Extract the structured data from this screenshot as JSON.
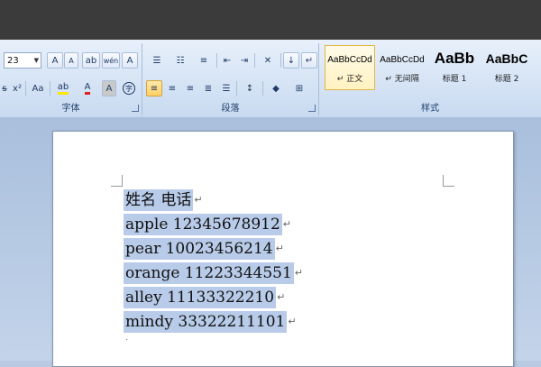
{
  "ribbon": {
    "font_group": {
      "label": "字体",
      "font_size": "23",
      "grow_label": "A",
      "shrink_label": "A",
      "clear_label": "ab",
      "phonetic_label": "wén",
      "border_char_label": "A",
      "superscript_label": "x²",
      "case_label": "Aa",
      "highlight_label": "ab",
      "font_color_label": "A",
      "char_shade_label": "A",
      "enclose_label": "字"
    },
    "paragraph_group": {
      "label": "段落"
    },
    "styles_group": {
      "label": "样式",
      "tiles": [
        {
          "sample": "AaBbCcDd",
          "name": "↵ 正文"
        },
        {
          "sample": "AaBbCcDd",
          "name": "↵ 无间隔"
        },
        {
          "sample": "AaBb",
          "name": "标题 1"
        },
        {
          "sample": "AaBbC",
          "name": "标题 2"
        }
      ]
    }
  },
  "document": {
    "lines": [
      "姓名 电话",
      "apple 12345678912",
      "pear 10023456214",
      "orange 11223344551",
      "alley 11133322210",
      "mindy 33322211101"
    ],
    "paragraph_mark": "↵"
  }
}
